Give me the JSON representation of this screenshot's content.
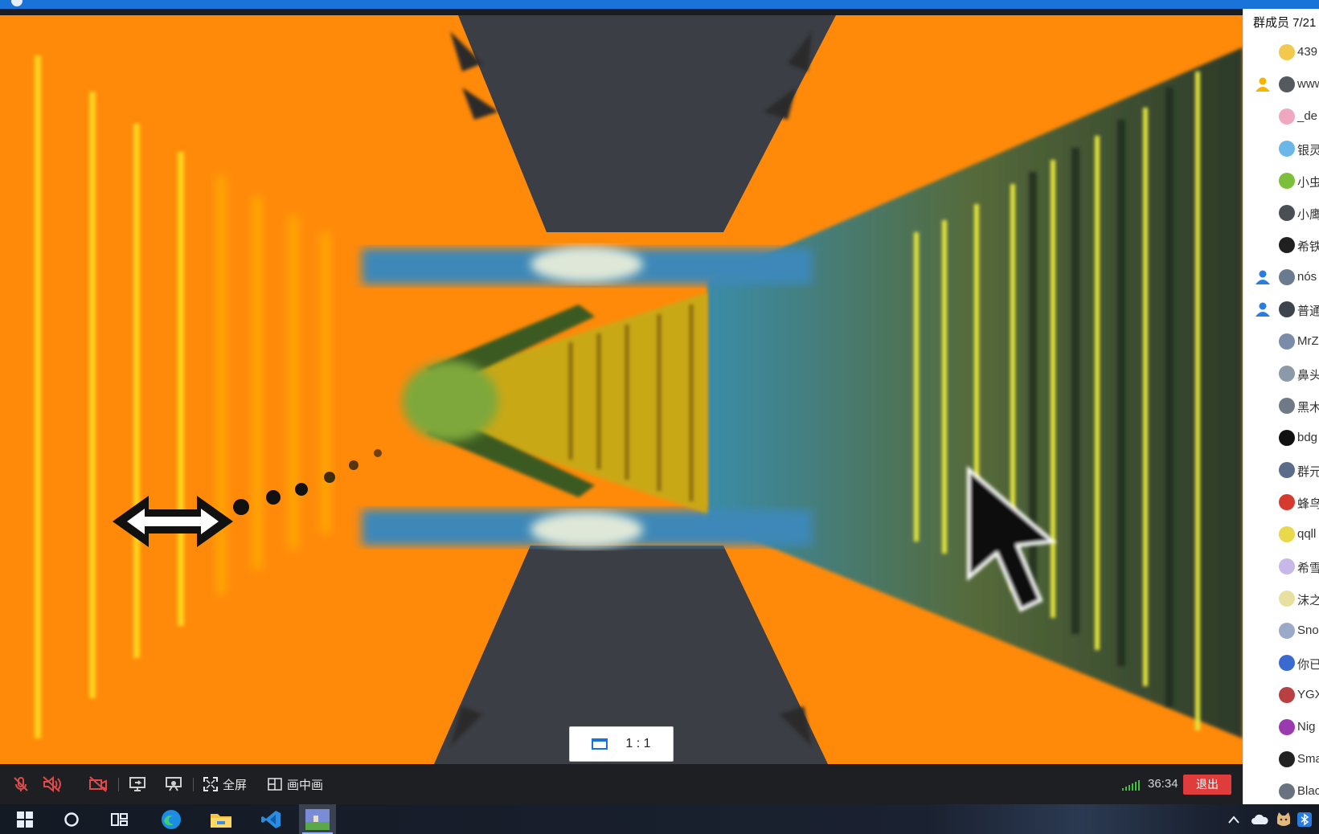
{
  "panel": {
    "title": "群成员 7/21",
    "members": [
      {
        "name": "439",
        "role": "",
        "avatar_color": "#f2c94c"
      },
      {
        "name": "www",
        "role": "owner",
        "avatar_color": "#555a60"
      },
      {
        "name": "_de",
        "role": "",
        "avatar_color": "#f0a8c0"
      },
      {
        "name": "银灵",
        "role": "",
        "avatar_color": "#6bb7e8"
      },
      {
        "name": "小虫",
        "role": "",
        "avatar_color": "#7cbf3a"
      },
      {
        "name": "小鹰",
        "role": "",
        "avatar_color": "#4a4f55"
      },
      {
        "name": "希铁",
        "role": "",
        "avatar_color": "#202020"
      },
      {
        "name": "nós",
        "role": "admin",
        "avatar_color": "#6a7a90"
      },
      {
        "name": "普通",
        "role": "admin",
        "avatar_color": "#3d444e"
      },
      {
        "name": "MrZ",
        "role": "",
        "avatar_color": "#7a8ca8"
      },
      {
        "name": "鼻头",
        "role": "",
        "avatar_color": "#8a9aa8"
      },
      {
        "name": "黑木",
        "role": "",
        "avatar_color": "#6f7a86"
      },
      {
        "name": "bdg",
        "role": "",
        "avatar_color": "#111111"
      },
      {
        "name": "群元",
        "role": "",
        "avatar_color": "#5a6c8a"
      },
      {
        "name": "蜂鸟",
        "role": "",
        "avatar_color": "#d63a2f"
      },
      {
        "name": "qqll",
        "role": "",
        "avatar_color": "#e8d84a"
      },
      {
        "name": "希雪",
        "role": "",
        "avatar_color": "#c8b8e8"
      },
      {
        "name": "沫之",
        "role": "",
        "avatar_color": "#e8e0a0"
      },
      {
        "name": "Sno",
        "role": "",
        "avatar_color": "#9aaac8"
      },
      {
        "name": "你已",
        "role": "",
        "avatar_color": "#3a6ad0"
      },
      {
        "name": "YGX",
        "role": "",
        "avatar_color": "#b84040"
      },
      {
        "name": "Nig",
        "role": "",
        "avatar_color": "#9a3ab0"
      },
      {
        "name": "Sma",
        "role": "",
        "avatar_color": "#222222"
      },
      {
        "name": "Blac",
        "role": "",
        "avatar_color": "#6a7280"
      }
    ]
  },
  "video": {
    "ratio_label": "1 : 1"
  },
  "controls": {
    "mic_icon": "mic-muted-icon",
    "speaker_icon": "speaker-muted-icon",
    "camera_icon": "camera-off-icon",
    "share_icon": "screen-share-icon",
    "presentation_icon": "presentation-icon",
    "fullscreen_label": "全屏",
    "pip_label": "画中画",
    "timer": "36:34",
    "exit_label": "退出",
    "signal_color": "#3ec53e",
    "exit_color": "#e03c3c"
  },
  "taskbar": {
    "apps": [
      "start-icon",
      "search-icon",
      "task-view-icon",
      "edge-icon",
      "file-explorer-icon",
      "vscode-icon",
      "game-app-icon"
    ],
    "tray": [
      "chevron-up-icon",
      "cloud-icon",
      "cat-icon",
      "bluetooth-icon"
    ]
  }
}
